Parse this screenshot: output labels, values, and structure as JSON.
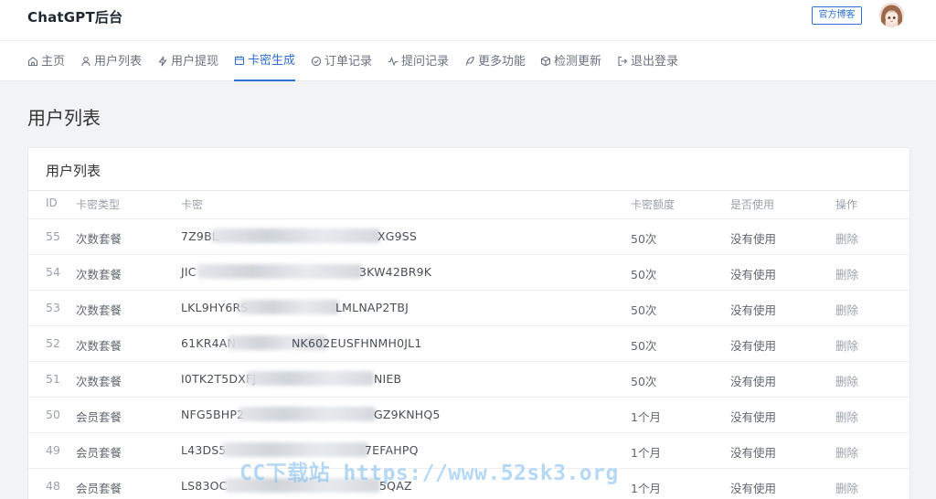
{
  "header": {
    "title": "ChatGPT后台",
    "blog_button": "官方博客"
  },
  "nav": {
    "items": [
      {
        "label": "主页",
        "icon": "home-icon"
      },
      {
        "label": "用户列表",
        "icon": "user-icon"
      },
      {
        "label": "用户提现",
        "icon": "bolt-icon"
      },
      {
        "label": "卡密生成",
        "icon": "calendar-icon",
        "active": true
      },
      {
        "label": "订单记录",
        "icon": "check-circle-icon"
      },
      {
        "label": "提问记录",
        "icon": "activity-icon"
      },
      {
        "label": "更多功能",
        "icon": "feather-icon"
      },
      {
        "label": "检测更新",
        "icon": "box-icon"
      },
      {
        "label": "退出登录",
        "icon": "logout-icon"
      }
    ],
    "active_color": "#2f6fd6"
  },
  "page": {
    "title": "用户列表"
  },
  "table": {
    "title": "用户列表",
    "columns": [
      "ID",
      "卡密类型",
      "卡密",
      "卡密额度",
      "是否使用",
      "操作"
    ],
    "rows": [
      {
        "id": "55",
        "type": "次数套餐",
        "key_start": "7Z9BL",
        "key_end": "XG9SS",
        "quota": "50次",
        "used": "没有使用",
        "action": "删除"
      },
      {
        "id": "54",
        "type": "次数套餐",
        "key_start": "JIC",
        "key_end": "3KW42BR9K",
        "quota": "50次",
        "used": "没有使用",
        "action": "删除"
      },
      {
        "id": "53",
        "type": "次数套餐",
        "key_start": "LKL9HY6RS",
        "key_end": "LMLNAP2TBJ",
        "quota": "50次",
        "used": "没有使用",
        "action": "删除"
      },
      {
        "id": "52",
        "type": "次数套餐",
        "key_start": "61KR4AN",
        "key_end": "NK602EUSFHNMH0JL1",
        "quota": "50次",
        "used": "没有使用",
        "action": "删除"
      },
      {
        "id": "51",
        "type": "次数套餐",
        "key_start": "I0TK2T5DXFJ",
        "key_end": "NIEB",
        "quota": "50次",
        "used": "没有使用",
        "action": "删除"
      },
      {
        "id": "50",
        "type": "会员套餐",
        "key_start": "NFG5BHP2",
        "key_end": "GZ9KNHQ5",
        "quota": "1个月",
        "used": "没有使用",
        "action": "删除"
      },
      {
        "id": "49",
        "type": "会员套餐",
        "key_start": "L43DS5",
        "key_end": "7EFAHPQ",
        "quota": "1个月",
        "used": "没有使用",
        "action": "删除"
      },
      {
        "id": "48",
        "type": "会员套餐",
        "key_start": "LS83OC",
        "key_end": "5QAZ",
        "quota": "1个月",
        "used": "没有使用",
        "action": "删除"
      }
    ]
  },
  "watermark": "CC下载站 https://www.52sk3.org"
}
